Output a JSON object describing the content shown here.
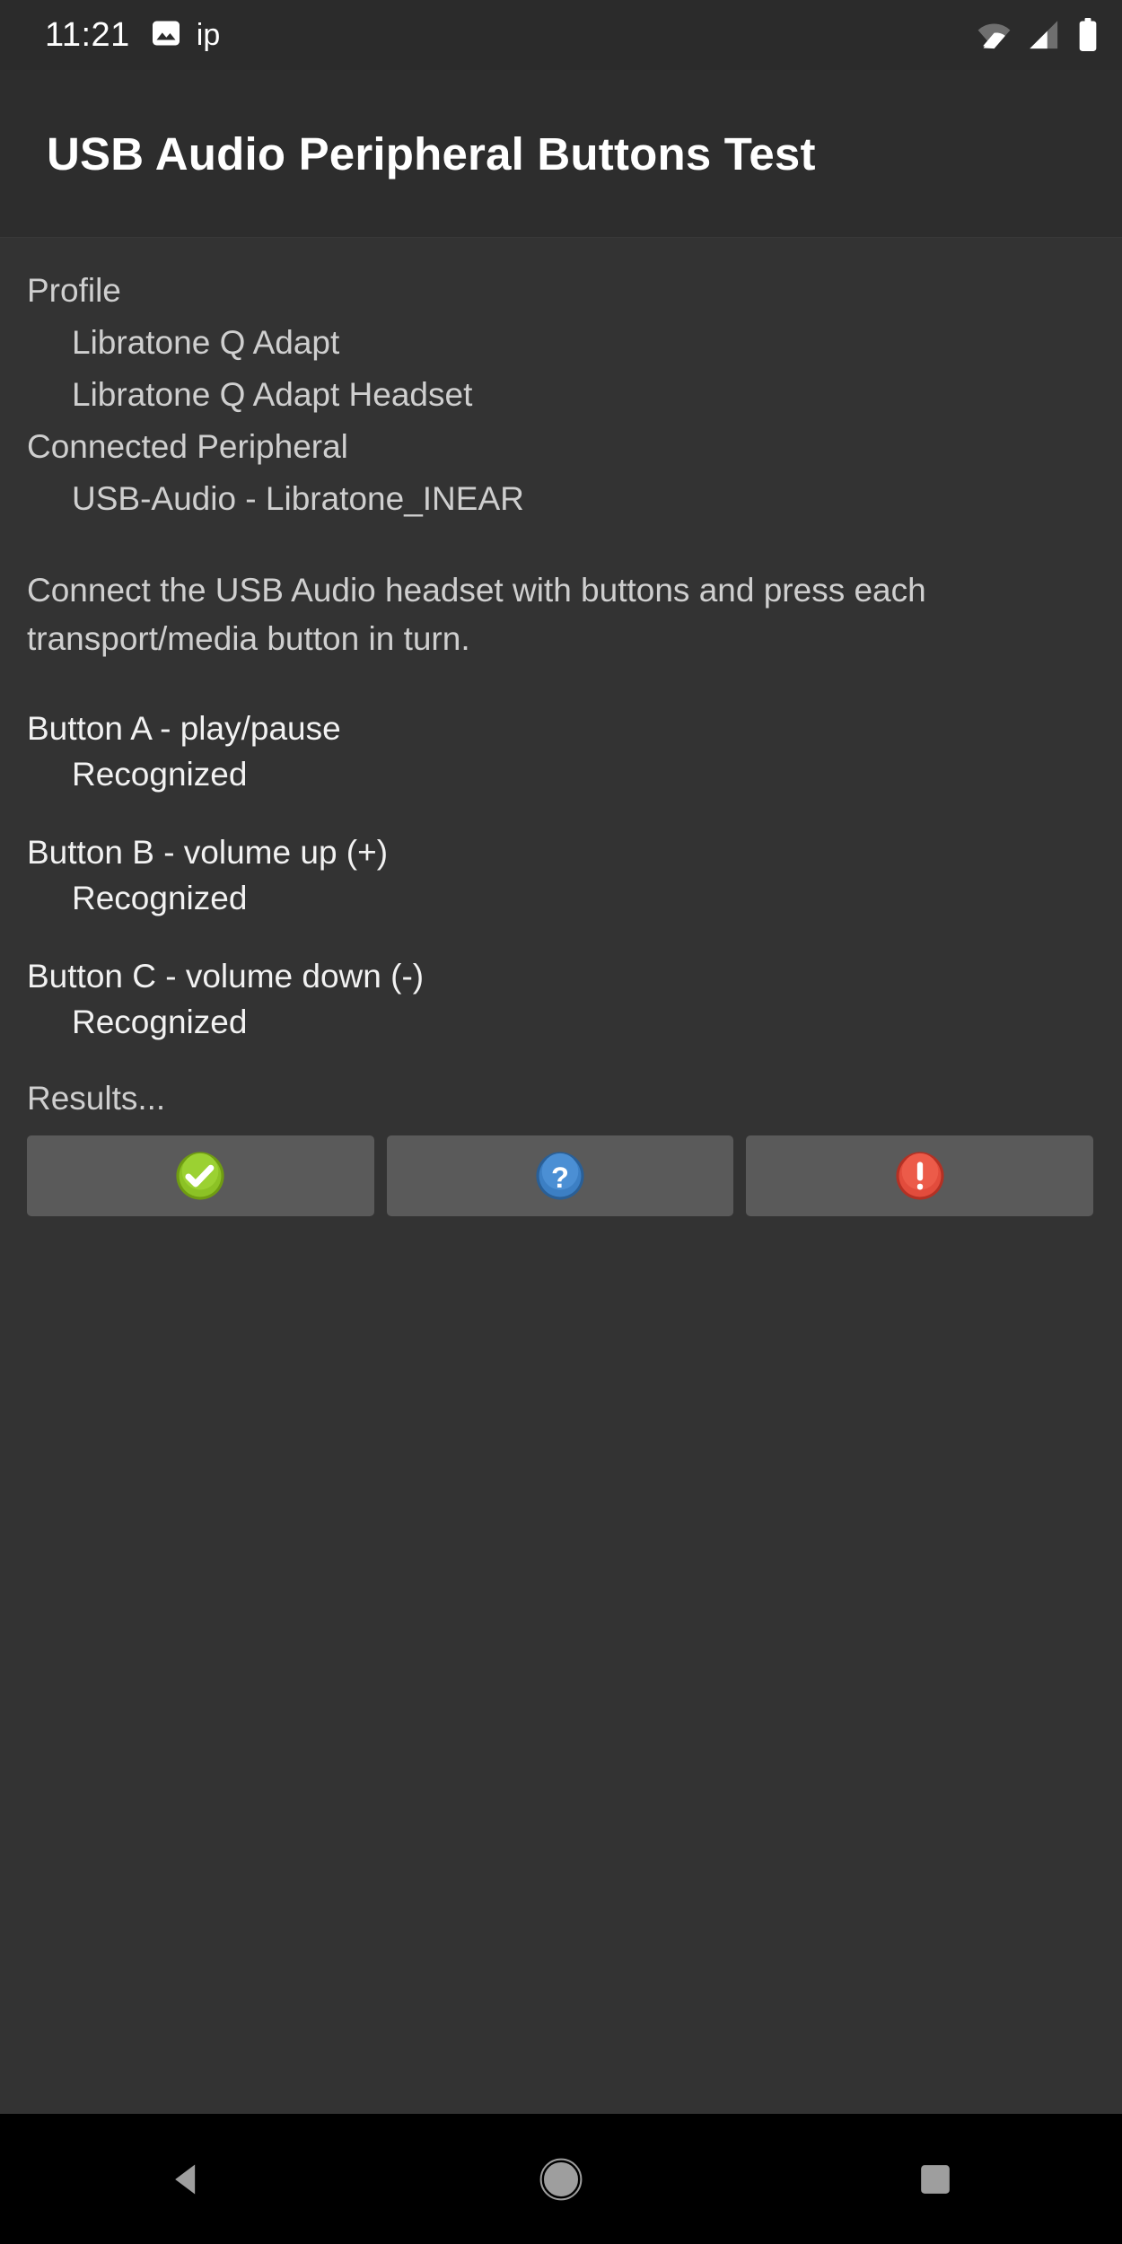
{
  "status_bar": {
    "clock": "11:21",
    "notification_text": "ip",
    "icons": {
      "notification": "image-icon",
      "wifi": "wifi-icon",
      "signal": "cellular-signal-icon",
      "battery": "battery-full-icon"
    }
  },
  "header": {
    "title": "USB Audio Peripheral Buttons Test"
  },
  "info": {
    "profile_label": "Profile",
    "profile_values": [
      "Libratone Q Adapt",
      "Libratone Q Adapt Headset"
    ],
    "peripheral_label": "Connected Peripheral",
    "peripheral_value": "USB-Audio - Libratone_INEAR"
  },
  "instructions": "Connect the USB Audio headset with buttons and press each transport/media button in turn.",
  "tests": [
    {
      "label": "Button A - play/pause",
      "status": "Recognized"
    },
    {
      "label": "Button B - volume up (+)",
      "status": "Recognized"
    },
    {
      "label": "Button C - volume down (-)",
      "status": "Recognized"
    }
  ],
  "results": {
    "label": "Results...",
    "buttons": [
      {
        "name": "pass-button",
        "icon": "check-circle-icon",
        "color": "#8CC225"
      },
      {
        "name": "info-button",
        "icon": "question-circle-icon",
        "color": "#3C7FC4"
      },
      {
        "name": "fail-button",
        "icon": "exclamation-circle-icon",
        "color": "#E24C3C"
      }
    ]
  },
  "nav_bar": {
    "back": "back-triangle-icon",
    "home": "home-circle-icon",
    "recents": "recents-square-icon"
  },
  "colors": {
    "background": "#333333",
    "title_bar": "#2d2d2d",
    "status_bar": "#2b2b2b",
    "button_face": "#5a5a5a",
    "primary_text": "#f2f2f2",
    "secondary_text": "#cfcfcf",
    "nav_bar": "#000000",
    "nav_icon": "#9e9e9e"
  }
}
